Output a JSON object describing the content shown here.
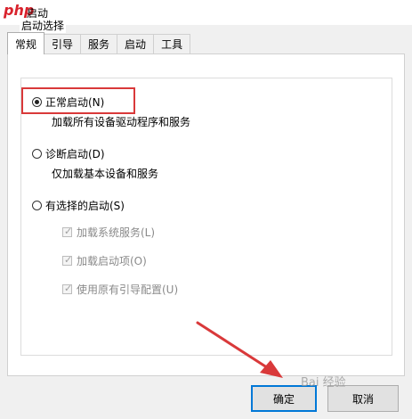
{
  "window": {
    "title": "启动"
  },
  "logo": {
    "text": "php"
  },
  "tabs": [
    {
      "label": "常规",
      "active": true
    },
    {
      "label": "引导",
      "active": false
    },
    {
      "label": "服务",
      "active": false
    },
    {
      "label": "启动",
      "active": false
    },
    {
      "label": "工具",
      "active": false
    }
  ],
  "startup": {
    "group_label": "启动选择",
    "options": [
      {
        "label": "正常启动(N)",
        "description": "加载所有设备驱动程序和服务",
        "checked": true
      },
      {
        "label": "诊断启动(D)",
        "description": "仅加载基本设备和服务",
        "checked": false
      },
      {
        "label": "有选择的启动(S)",
        "checked": false
      }
    ],
    "sub_options": [
      {
        "label": "加载系统服务(L)",
        "checked": true,
        "enabled": false
      },
      {
        "label": "加载启动项(O)",
        "checked": true,
        "enabled": false
      },
      {
        "label": "使用原有引导配置(U)",
        "checked": true,
        "enabled": false
      }
    ]
  },
  "buttons": {
    "ok": "确定",
    "cancel": "取消"
  },
  "colors": {
    "highlight": "#d9393a",
    "accent": "#0078d7"
  },
  "watermark": "Bai 经验"
}
